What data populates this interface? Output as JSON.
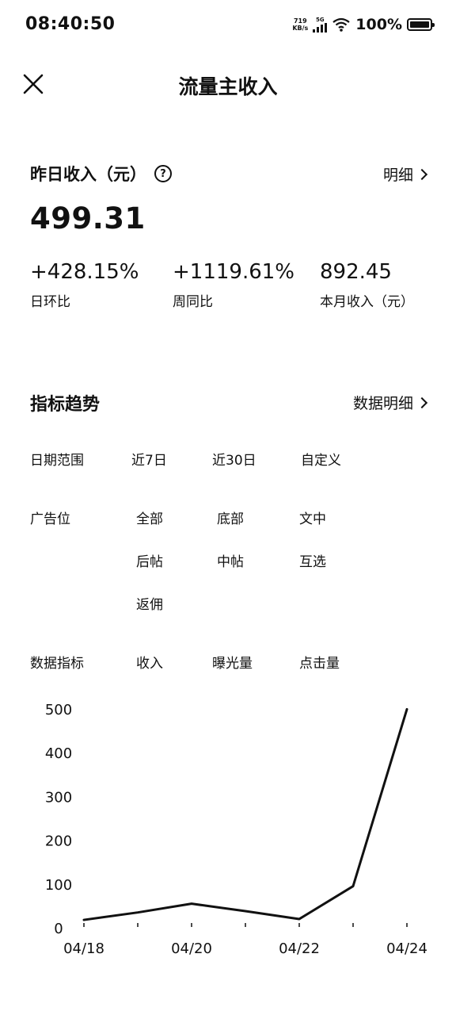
{
  "status_bar": {
    "time": "08:40:50",
    "net_speed_value": "719",
    "net_speed_unit": "KB/s",
    "signal_label": "5G",
    "battery": "100%"
  },
  "nav": {
    "title": "流量主收入",
    "close_icon": "close-icon"
  },
  "income": {
    "yesterday_label": "昨日收入（元）",
    "help_icon": "help-circle-icon",
    "detail_link": "明细",
    "amount": "499.31",
    "stats": [
      {
        "value": "+428.15%",
        "label": "日环比"
      },
      {
        "value": "+1119.61%",
        "label": "周同比"
      },
      {
        "value": "892.45",
        "label": "本月收入（元）"
      }
    ]
  },
  "trend": {
    "title": "指标趋势",
    "detail_link": "数据明细",
    "date_range": {
      "label": "日期范围",
      "options": [
        "近7日",
        "近30日",
        "自定义"
      ]
    },
    "ad_slot": {
      "label": "广告位",
      "options": [
        "全部",
        "底部",
        "文中",
        "后帖",
        "中帖",
        "互选",
        "返佣"
      ]
    },
    "metric": {
      "label": "数据指标",
      "options": [
        "收入",
        "曝光量",
        "点击量"
      ]
    }
  },
  "chart_data": {
    "type": "line",
    "x": [
      "04/18",
      "04/19",
      "04/20",
      "04/21",
      "04/22",
      "04/23",
      "04/24"
    ],
    "x_tick_labels": [
      "04/18",
      "04/20",
      "04/22",
      "04/24"
    ],
    "series": [
      {
        "values": [
          18,
          35,
          55,
          38,
          20,
          95,
          499.31
        ]
      }
    ],
    "yticks": [
      0,
      100,
      200,
      300,
      400,
      500
    ],
    "ylim": [
      0,
      500
    ],
    "grid": false,
    "line_color": "#111111"
  }
}
